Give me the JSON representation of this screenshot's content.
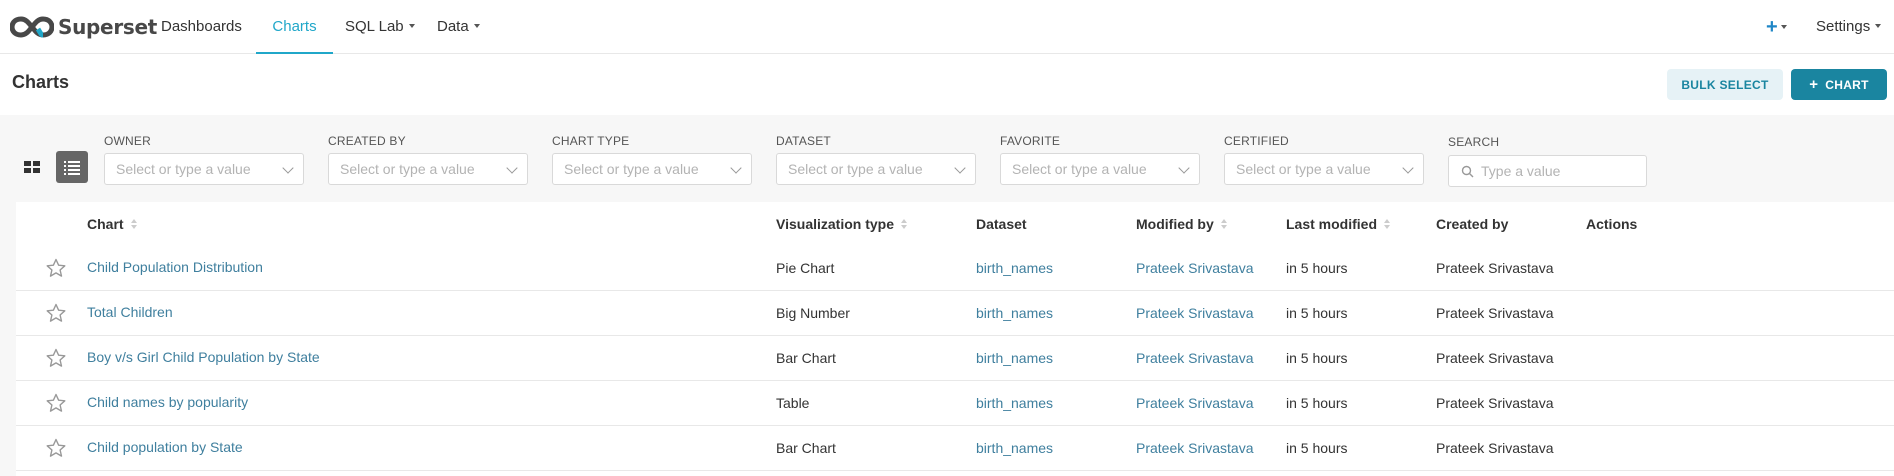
{
  "brand": {
    "name": "Superset"
  },
  "nav": {
    "items": [
      {
        "label": "Dashboards"
      },
      {
        "label": "Charts"
      },
      {
        "label": "SQL Lab"
      },
      {
        "label": "Data"
      }
    ],
    "settings_label": "Settings",
    "plus_icon": "plus-icon"
  },
  "page": {
    "title": "Charts",
    "bulk_select_label": "BULK SELECT",
    "add_chart_label": "CHART"
  },
  "filters": [
    {
      "label": "OWNER",
      "placeholder": "Select or type a value"
    },
    {
      "label": "CREATED BY",
      "placeholder": "Select or type a value"
    },
    {
      "label": "CHART TYPE",
      "placeholder": "Select or type a value"
    },
    {
      "label": "DATASET",
      "placeholder": "Select or type a value"
    },
    {
      "label": "FAVORITE",
      "placeholder": "Select or type a value"
    },
    {
      "label": "CERTIFIED",
      "placeholder": "Select or type a value"
    }
  ],
  "search": {
    "label": "SEARCH",
    "placeholder": "Type a value"
  },
  "table": {
    "columns": [
      "Chart",
      "Visualization type",
      "Dataset",
      "Modified by",
      "Last modified",
      "Created by",
      "Actions"
    ],
    "rows": [
      {
        "chart": "Child Population Distribution",
        "viz": "Pie Chart",
        "dataset": "birth_names",
        "modified_by": "Prateek Srivastava",
        "last_modified": "in 5 hours",
        "created_by": "Prateek Srivastava"
      },
      {
        "chart": "Total Children",
        "viz": "Big Number",
        "dataset": "birth_names",
        "modified_by": "Prateek Srivastava",
        "last_modified": "in 5 hours",
        "created_by": "Prateek Srivastava"
      },
      {
        "chart": "Boy v/s Girl Child Population by State",
        "viz": "Bar Chart",
        "dataset": "birth_names",
        "modified_by": "Prateek Srivastava",
        "last_modified": "in 5 hours",
        "created_by": "Prateek Srivastava"
      },
      {
        "chart": "Child names by popularity",
        "viz": "Table",
        "dataset": "birth_names",
        "modified_by": "Prateek Srivastava",
        "last_modified": "in 5 hours",
        "created_by": "Prateek Srivastava"
      },
      {
        "chart": "Child population by State",
        "viz": "Bar Chart",
        "dataset": "birth_names",
        "modified_by": "Prateek Srivastava",
        "last_modified": "in 5 hours",
        "created_by": "Prateek Srivastava"
      }
    ]
  },
  "colors": {
    "accent": "#20a7c9",
    "primary_button": "#1a85a0",
    "link": "#3f7f9e"
  }
}
